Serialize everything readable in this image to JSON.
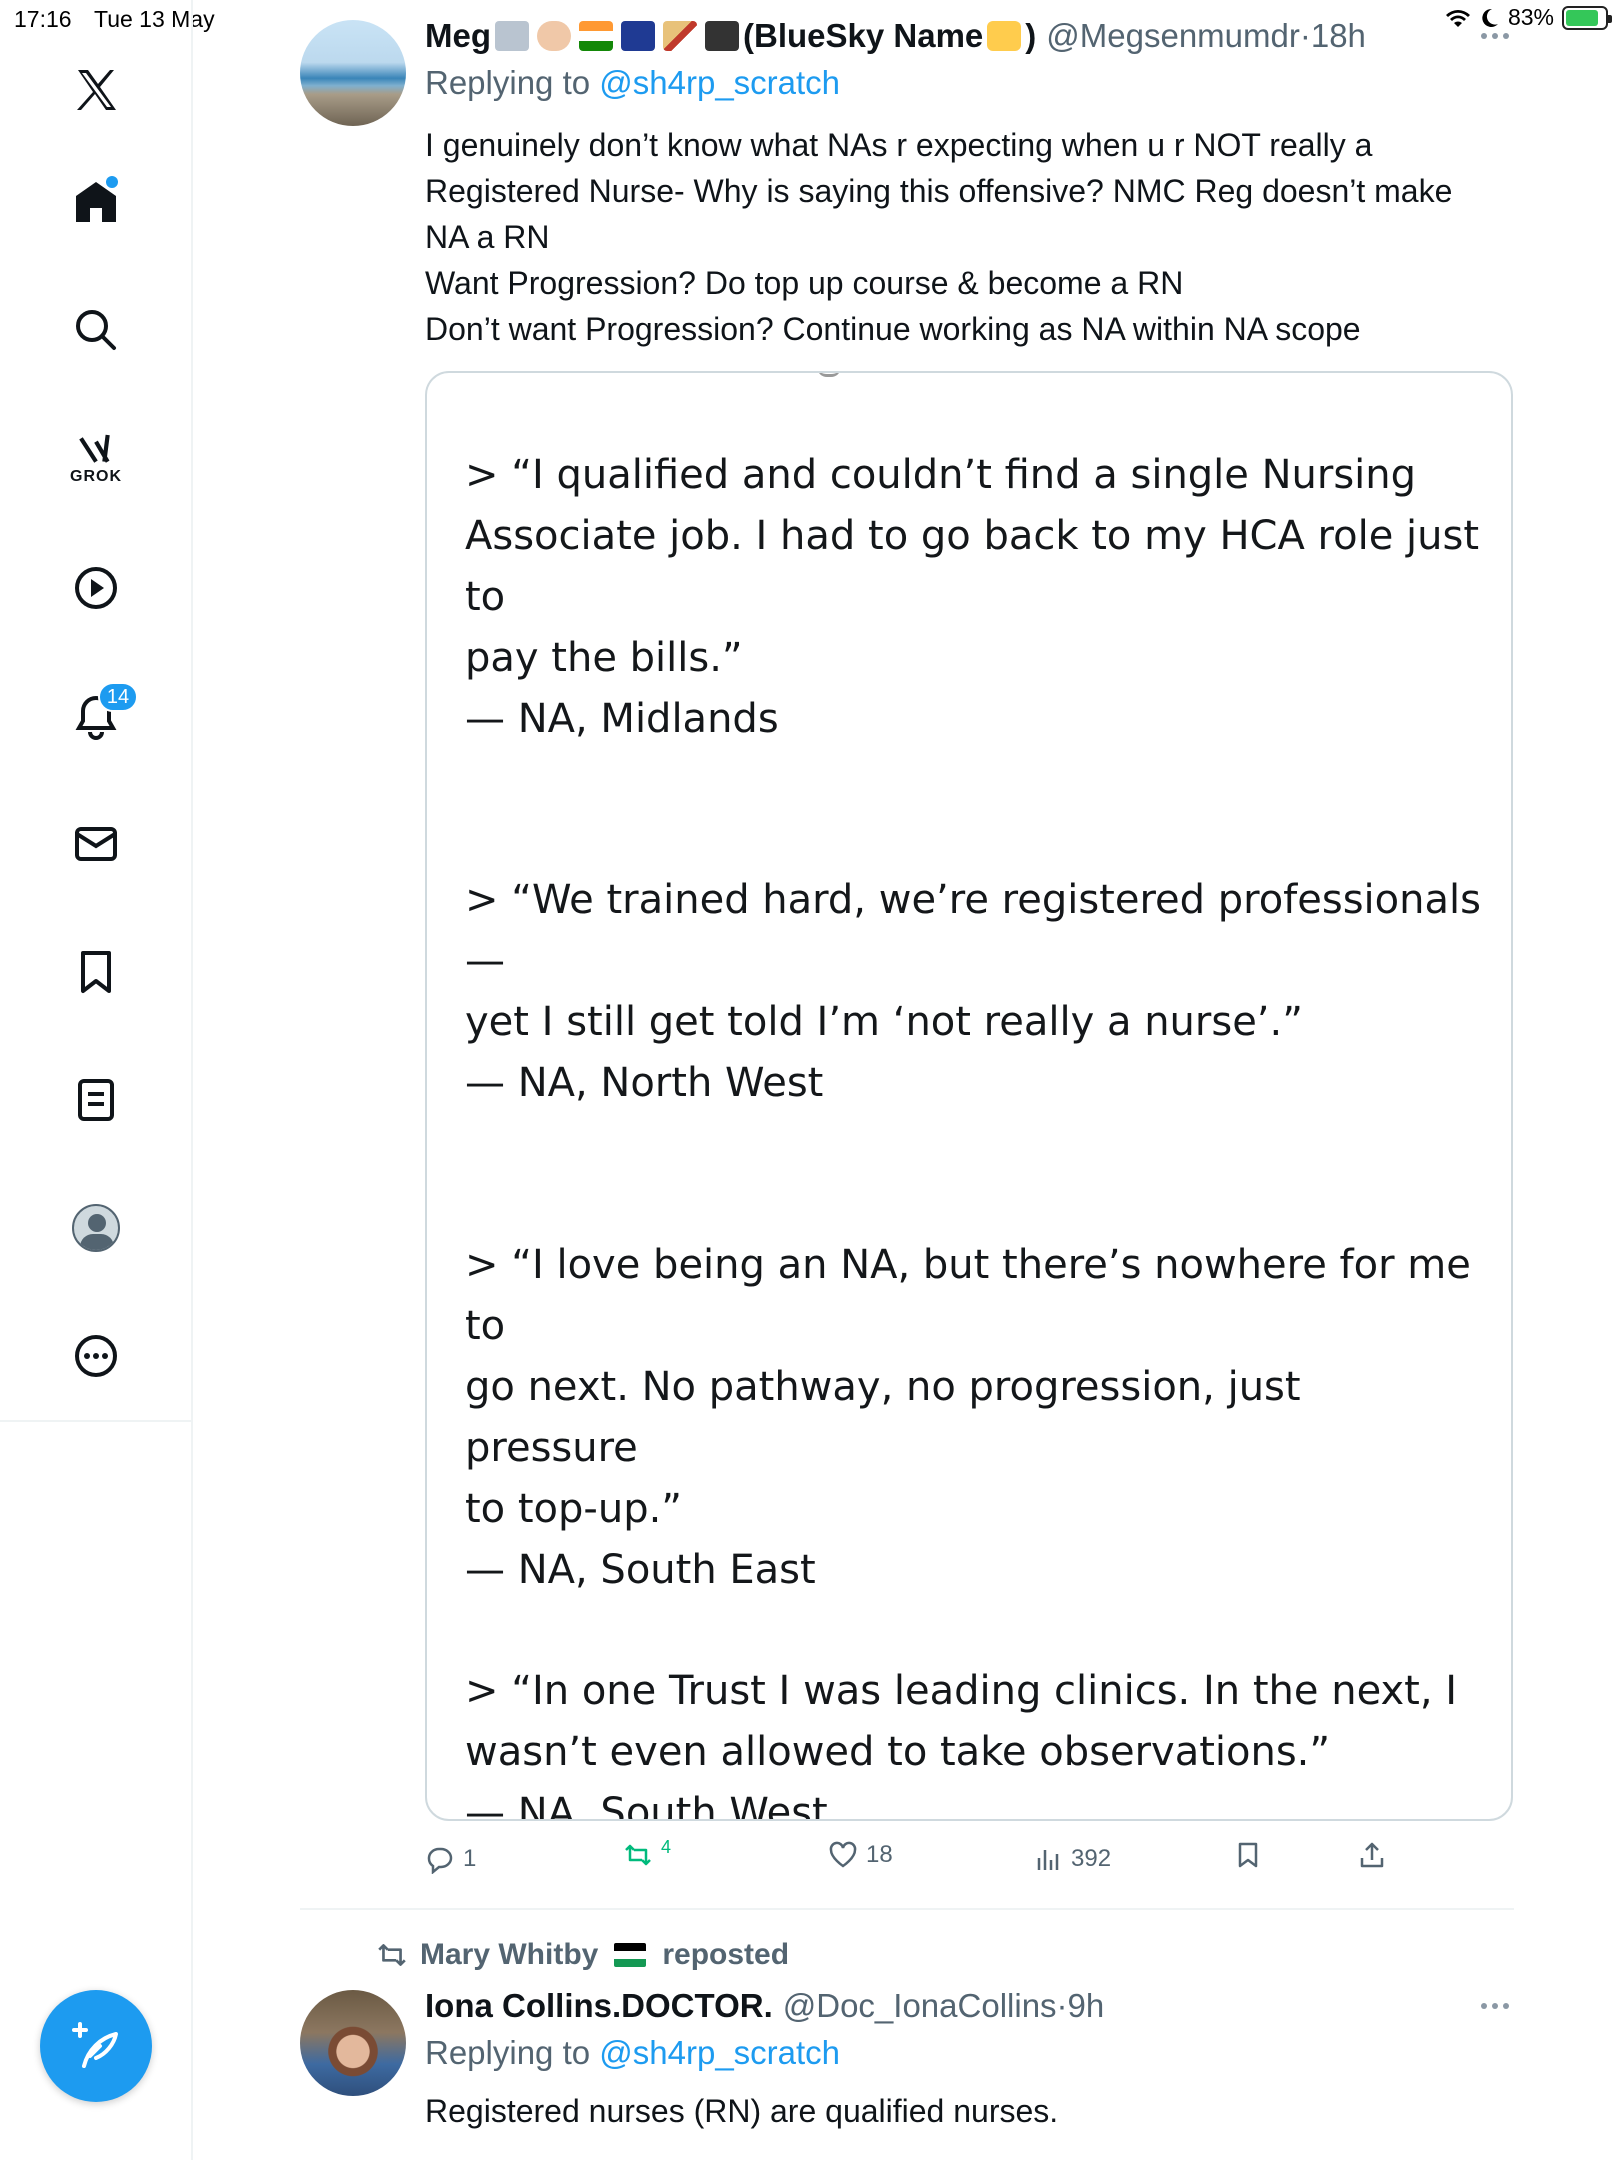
{
  "status_bar": {
    "time": "17:16",
    "date": "Tue 13 May",
    "battery": "83%",
    "battery_level": 0.83
  },
  "sidebar": {
    "grok_label": "GROK",
    "notifications_count": "14"
  },
  "tweet": {
    "author_name": "Meg",
    "author_suffix": "(BlueSky Name",
    "author_close": ")",
    "handle": "@Megsenmumdr",
    "time_sep": " · ",
    "time": "18h",
    "replying_prefix": "Replying to ",
    "replying_to": "@sh4rp_scratch",
    "text_lines": [
      "I genuinely don’t know what NAs r expecting when u r NOT really a",
      "Registered Nurse- Why is saying this offensive? NMC Reg doesn’t make",
      "NA a RN",
      "Want Progression? Do top up course & become a RN",
      "Don’t want Progression? Continue working as NA within NA scope"
    ],
    "image_quotes": [
      {
        "lines": [
          "> “I qualified and couldn’t find a single Nursing",
          "Associate job. I had to go back to my HCA role just to",
          "pay the bills.”",
          "— NA, Midlands"
        ]
      },
      {
        "lines": [
          "> “We trained hard, we’re registered professionals —",
          "yet I still get told I’m ‘not really a nurse’.”",
          "— NA, North West"
        ]
      },
      {
        "lines": [
          "> “I love being an NA, but there’s nowhere for me to",
          "go next. No pathway, no progression, just pressure",
          "to top-up.”",
          "— NA, South East"
        ]
      },
      {
        "lines": [
          "> “In one Trust I was leading clinics. In the next, I",
          "wasn’t even allowed to take observations.”",
          "— NA, South West"
        ]
      }
    ],
    "actions": {
      "replies": "1",
      "reposts": "4",
      "likes": "18",
      "views": "392"
    }
  },
  "next_tweet": {
    "reposted_by": "Mary Whitby",
    "reposted_label": "reposted",
    "author_name": "Iona Collins.DOCTOR.",
    "handle": "@Doc_IonaCollins",
    "time_sep": " · ",
    "time": "9h",
    "replying_prefix": "Replying to ",
    "replying_to": "@sh4rp_scratch",
    "text": "Registered nurses (RN) are qualified nurses."
  },
  "colors": {
    "accent": "#1d9bf0",
    "repost_green": "#00ba7c",
    "secondary_text": "#536471",
    "border": "#cfd9de"
  }
}
